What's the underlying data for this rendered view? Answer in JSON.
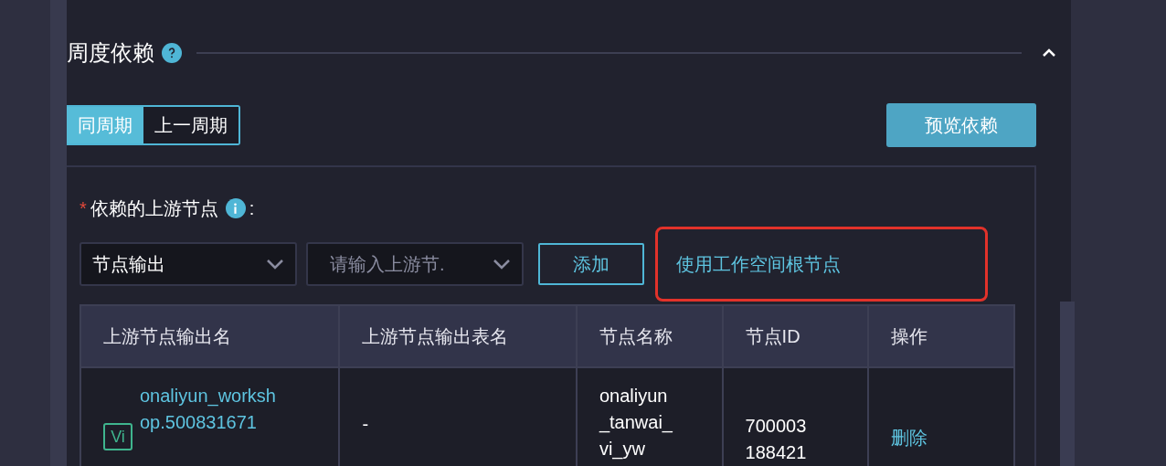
{
  "section": {
    "title": "周度依赖",
    "expanded": true
  },
  "cycle_tabs": [
    {
      "label": "同周期",
      "selected": true
    },
    {
      "label": "上一周期",
      "selected": false
    }
  ],
  "preview_button": "预览依赖",
  "upstream": {
    "required_mark": "*",
    "label": "依赖的上游节点",
    "colon": ":",
    "type_select": {
      "value": "节点输出"
    },
    "node_select": {
      "placeholder": "请输入上游节."
    },
    "add_button": "添加",
    "root_link": "使用工作空间根节点",
    "table": {
      "columns": [
        "上游节点输出名",
        "上游节点输出表名",
        "节点名称",
        "节点ID",
        "操作"
      ],
      "rows": [
        {
          "badge": "Vi",
          "output_name": "onaliyun_workshop.500831671",
          "table_name": "-",
          "node_name": "onaliyun_tanwai_vi_yw",
          "node_id": "700003188421",
          "action": "删除"
        }
      ]
    }
  }
}
